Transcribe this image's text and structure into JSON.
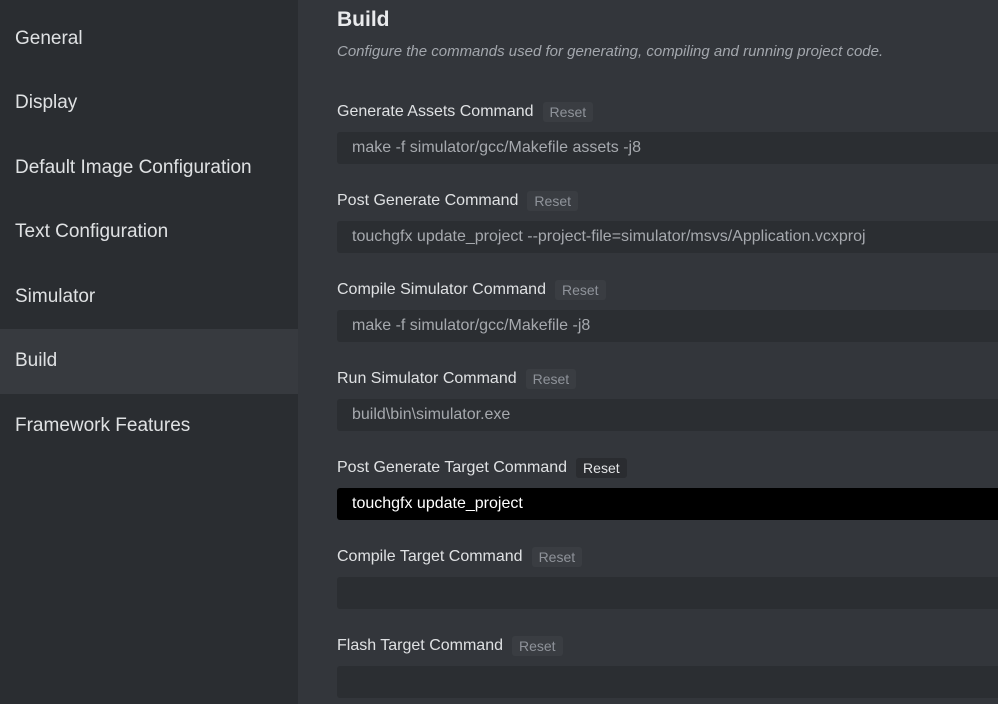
{
  "sidebar": {
    "items": [
      {
        "label": "General"
      },
      {
        "label": "Display"
      },
      {
        "label": "Default Image Configuration"
      },
      {
        "label": "Text Configuration"
      },
      {
        "label": "Simulator"
      },
      {
        "label": "Build",
        "active": true
      },
      {
        "label": "Framework Features"
      }
    ]
  },
  "main": {
    "title": "Build",
    "subtitle": "Configure the commands used for generating, compiling and running project code.",
    "fields": [
      {
        "label": "Generate Assets Command",
        "reset_label": "Reset",
        "value": "make -f simulator/gcc/Makefile assets -j8"
      },
      {
        "label": "Post Generate Command",
        "reset_label": "Reset",
        "value": "touchgfx update_project --project-file=simulator/msvs/Application.vcxproj"
      },
      {
        "label": "Compile Simulator Command",
        "reset_label": "Reset",
        "value": "make -f simulator/gcc/Makefile -j8"
      },
      {
        "label": "Run Simulator Command",
        "reset_label": "Reset",
        "value": "build\\bin\\simulator.exe"
      },
      {
        "label": "Post Generate Target Command",
        "reset_label": "Reset",
        "value": "touchgfx update_project",
        "focused": true
      },
      {
        "label": "Compile Target Command",
        "reset_label": "Reset",
        "value": ""
      },
      {
        "label": "Flash Target Command",
        "reset_label": "Reset",
        "value": ""
      }
    ]
  },
  "colors": {
    "sidebar_bg": "#2a2d31",
    "sidebar_active_bg": "#373a3f",
    "main_bg": "#33363b",
    "input_bg": "#2b2e32",
    "input_focused_bg": "#000000"
  }
}
